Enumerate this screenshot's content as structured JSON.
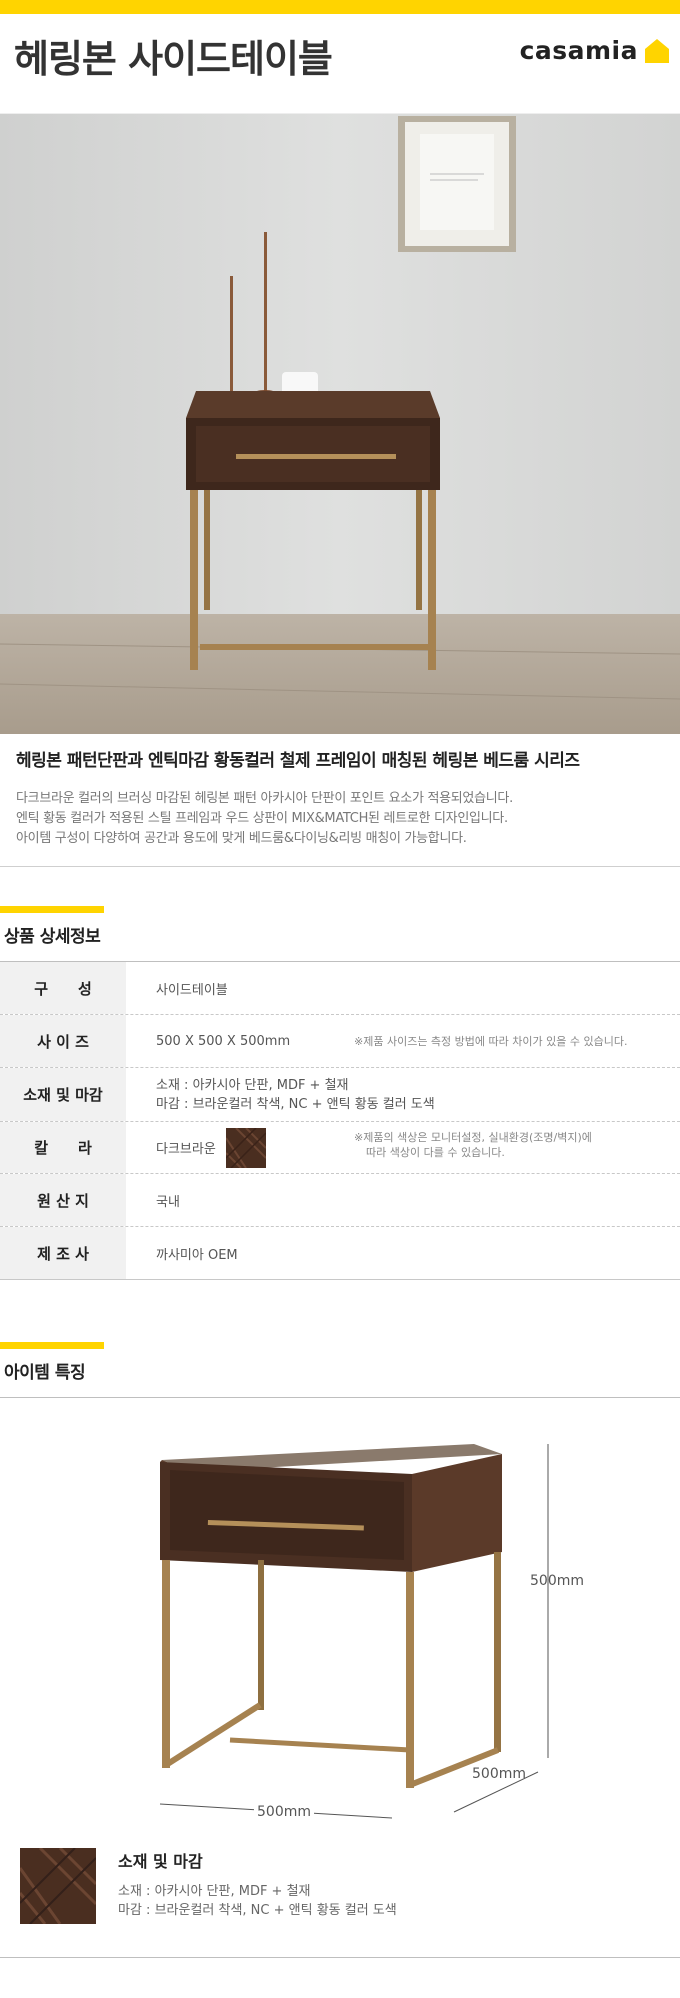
{
  "header": {
    "title": "헤링본 사이드테이블",
    "logo_text": "casamia",
    "accent": "#ffd400"
  },
  "intro": {
    "headline": "헤링본 패턴단판과 엔틱마감 황동컬러 철제 프레임이 매칭된 헤링본 베드룸 시리즈",
    "lines": [
      "다크브라운 컬러의 브러싱 마감된 헤링본 패턴 아카시아 단판이 포인트 요소가 적용되었습니다.",
      "엔틱 황동 컬러가 적용된 스틸 프레임과 우드 상판이 MIX&MATCH된 레트로한 디자인입니다.",
      "아이템 구성이 다양하여 공간과 용도에 맞게 베드룸&다이닝&리빙 매칭이 가능합니다."
    ]
  },
  "spec": {
    "title": "상품 상세정보",
    "rows": {
      "composition": {
        "label": "구　　성",
        "value": "사이드테이블"
      },
      "size": {
        "label": "사 이 즈",
        "value": "500 X 500 X 500mm",
        "note": "※제품 사이즈는 측정 방법에 따라 차이가 있을 수 있습니다."
      },
      "material": {
        "label": "소재 및 마감",
        "line1": "소재 : 아카시아 단판, MDF + 철재",
        "line2": "마감 : 브라운컬러 착색, NC + 앤틱 황동 컬러 도색"
      },
      "color": {
        "label": "칼　　라",
        "value": "다크브라운",
        "note1": "※제품의 색상은 모니터설정, 실내환경(조명/벽지)에",
        "note2": "따라 색상이 다를 수 있습니다.",
        "swatch_color": "#4a2e20"
      },
      "origin": {
        "label": "원 산 지",
        "value": "국내"
      },
      "maker": {
        "label": "제 조 사",
        "value": "까사미아 OEM"
      }
    }
  },
  "feature": {
    "title": "아이템 특징",
    "height_label": "500mm",
    "depth_label": "500mm",
    "width_label": "500mm"
  },
  "material_block": {
    "title": "소재 및 마감",
    "line1": "소재 : 아카시아 단판, MDF + 철재",
    "line2": "마감 : 브라운컬러 착색, NC + 앤틱 황동 컬러 도색"
  }
}
